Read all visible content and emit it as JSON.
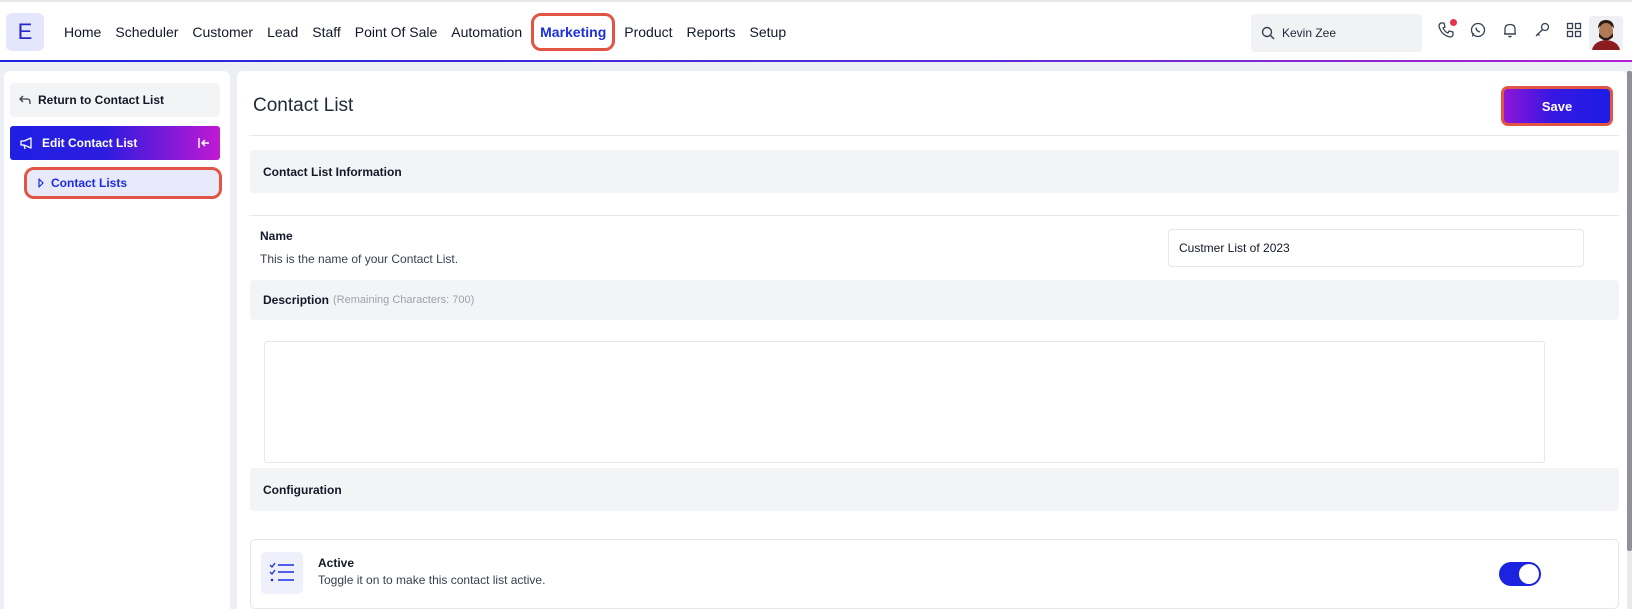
{
  "app": {
    "logo_letter": "E"
  },
  "nav": {
    "items": [
      "Home",
      "Scheduler",
      "Customer",
      "Lead",
      "Staff",
      "Point Of Sale",
      "Automation",
      "Marketing",
      "Product",
      "Reports",
      "Setup"
    ],
    "active": "Marketing"
  },
  "search": {
    "value": "Kevin Zee"
  },
  "top_icons": [
    "phone-icon",
    "whatsapp-icon",
    "bell-icon",
    "key-icon",
    "grid-icon"
  ],
  "sidebar": {
    "return_label": "Return to Contact List",
    "section_label": "Edit Contact List",
    "sub_item_label": "Contact Lists"
  },
  "main": {
    "title": "Contact List",
    "save_label": "Save",
    "info_section": "Contact List Information",
    "name_label": "Name",
    "name_help": "This is the name of your Contact List.",
    "name_value": "Custmer List of 2023",
    "description_label": "Description",
    "description_hint": "(Remaining Characters: 700)",
    "description_value": "",
    "config_section": "Configuration",
    "active_title": "Active",
    "active_desc": "Toggle it on to make this contact list active.",
    "active_on": true
  },
  "colors": {
    "accent": "#1b2ee0",
    "highlight": "#e25544",
    "gradient_end": "#c11ad2"
  }
}
